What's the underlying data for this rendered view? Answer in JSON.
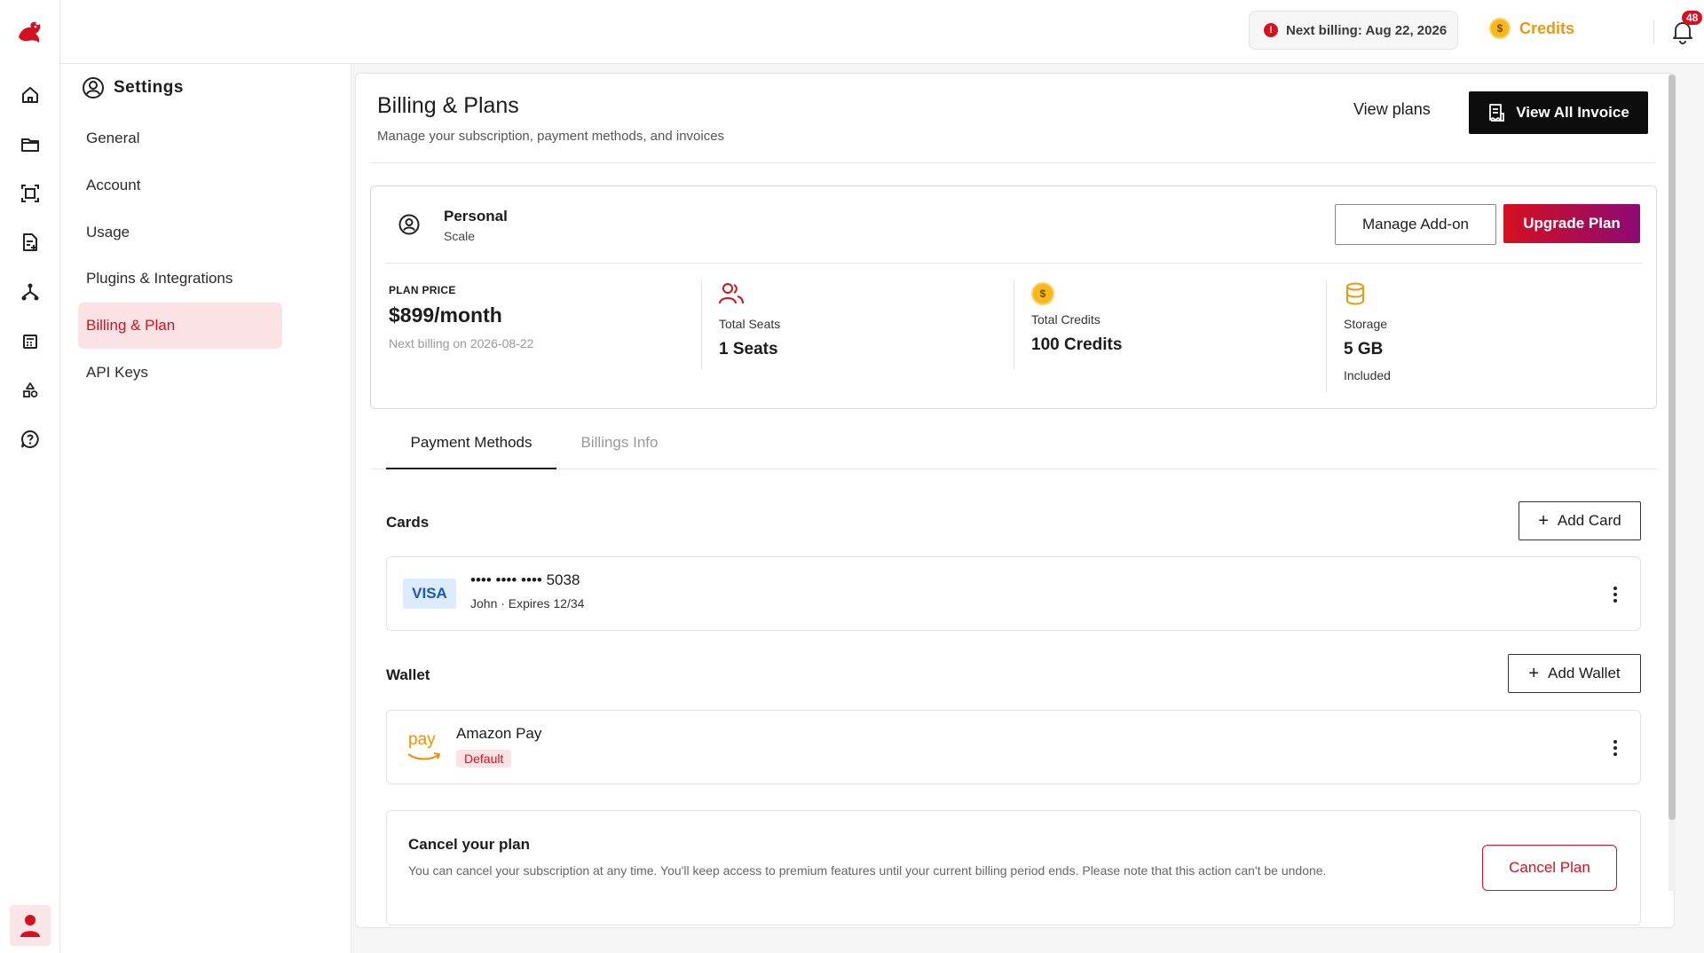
{
  "topbar": {
    "next_billing": "Next billing: Aug 22, 2026",
    "credits_label": "Credits",
    "notification_count": "48"
  },
  "rail": {
    "icons": [
      "home-icon",
      "folder-icon",
      "scan-icon",
      "document-add-icon",
      "workflow-icon",
      "calculator-icon",
      "shapes-icon",
      "help-icon"
    ]
  },
  "settings": {
    "title": "Settings",
    "items": [
      {
        "label": "General"
      },
      {
        "label": "Account"
      },
      {
        "label": "Usage"
      },
      {
        "label": "Plugins & Integrations"
      },
      {
        "label": "Billing & Plan"
      },
      {
        "label": "API Keys"
      }
    ],
    "active_index": 4
  },
  "main": {
    "title": "Billing & Plans",
    "subtitle": "Manage your subscription, payment methods, and invoices",
    "view_plans": "View plans",
    "view_all_invoice": "View All Invoice"
  },
  "plan": {
    "name": "Personal",
    "tier": "Scale",
    "manage_addon": "Manage Add-on",
    "upgrade": "Upgrade Plan",
    "price_label": "PLAN PRICE",
    "price": "$899/month",
    "next_billing": "Next billing on 2026-08-22",
    "seats_label": "Total Seats",
    "seats_value": "1 Seats",
    "credits_label": "Total Credits",
    "credits_value": "100 Credits",
    "storage_label": "Storage",
    "storage_value": "5 GB",
    "storage_sub": "Included"
  },
  "tabs": [
    {
      "label": "Payment Methods"
    },
    {
      "label": "Billings Info"
    }
  ],
  "cards": {
    "label": "Cards",
    "add_label": "Add Card",
    "brand": "VISA",
    "number": "•••• •••• •••• 5038",
    "details": "John · Expires 12/34"
  },
  "wallet": {
    "label": "Wallet",
    "add_label": "Add Wallet",
    "logo_text": "pay",
    "name": "Amazon Pay",
    "badge": "Default"
  },
  "cancel": {
    "title": "Cancel your plan",
    "description": "You can cancel your subscription at any time. You'll keep access to premium features until your current billing period ends. Please note that this action can't be undone.",
    "button": "Cancel Plan"
  },
  "colors": {
    "accent": "#d5101f",
    "accent_soft": "#fbe3e5",
    "credits": "#e89a0c"
  }
}
